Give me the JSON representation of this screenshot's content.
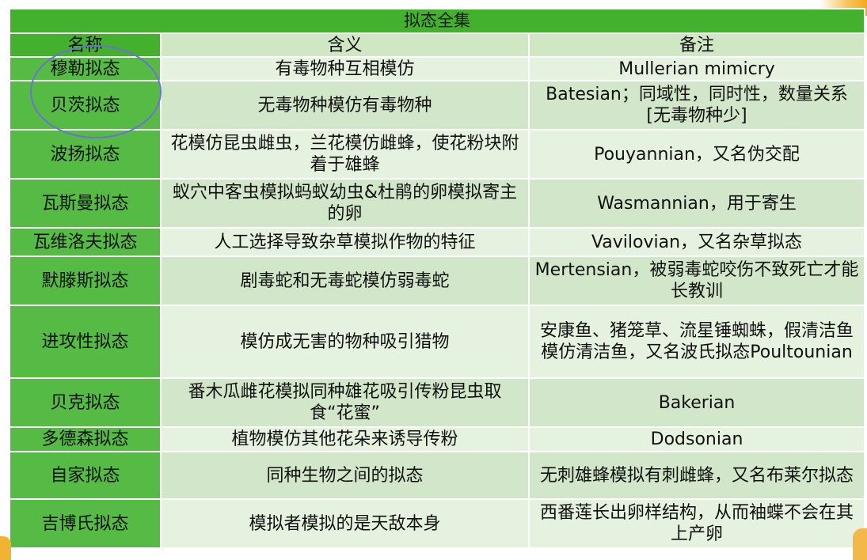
{
  "table": {
    "title": "拟态全集",
    "headers": [
      "名称",
      "含义",
      "备注"
    ],
    "rows": [
      {
        "name": "穆勒拟态",
        "meaning": "有毒物种互相模仿",
        "note": "Mullerian mimicry"
      },
      {
        "name": "贝茨拟态",
        "meaning": "无毒物种模仿有毒物种",
        "note": "Batesian；同域性，同时性，数量关系[无毒物种少]"
      },
      {
        "name": "波扬拟态",
        "meaning": "花模仿昆虫雌虫，兰花模仿雌蜂，使花粉块附着于雄蜂",
        "note": "Pouyannian，又名伪交配"
      },
      {
        "name": "瓦斯曼拟态",
        "meaning": "蚁穴中客虫模拟蚂蚁幼虫&杜鹃的卵模拟寄主的卵",
        "note": "Wasmannian，用于寄生"
      },
      {
        "name": "瓦维洛夫拟态",
        "meaning": "人工选择导致杂草模拟作物的特征",
        "note": "Vavilovian，又名杂草拟态"
      },
      {
        "name": "默滕斯拟态",
        "meaning": "剧毒蛇和无毒蛇模仿弱毒蛇",
        "note": "Mertensian，被弱毒蛇咬伤不致死亡才能长教训"
      },
      {
        "name": "进攻性拟态",
        "meaning": "模仿成无害的物种吸引猎物",
        "note": "安康鱼、猪笼草、流星锤蜘蛛，假清洁鱼模仿清洁鱼，又名波氏拟态Poultounian"
      },
      {
        "name": "贝克拟态",
        "meaning": "番木瓜雌花模拟同种雄花吸引传粉昆虫取食“花蜜”",
        "note": "Bakerian"
      },
      {
        "name": "多德森拟态",
        "meaning": "植物模仿其他花朵来诱导传粉",
        "note": "Dodsonian"
      },
      {
        "name": "自家拟态",
        "meaning": "同种生物之间的拟态",
        "note": "无刺雄蜂模拟有刺雌蜂，又名布莱尔拟态"
      },
      {
        "name": "吉博氏拟态",
        "meaning": "模拟者模拟的是天敌本身",
        "note": "西番莲长出卵样结构，从而袖蝶不会在其上产卵"
      }
    ]
  },
  "colors": {
    "title_bg": "#43b12d",
    "name_cell_bg": "#56bb44",
    "row_light": "#e6f2e0",
    "row_dark": "#d2e7c9",
    "circle": "#6f6fd8"
  }
}
